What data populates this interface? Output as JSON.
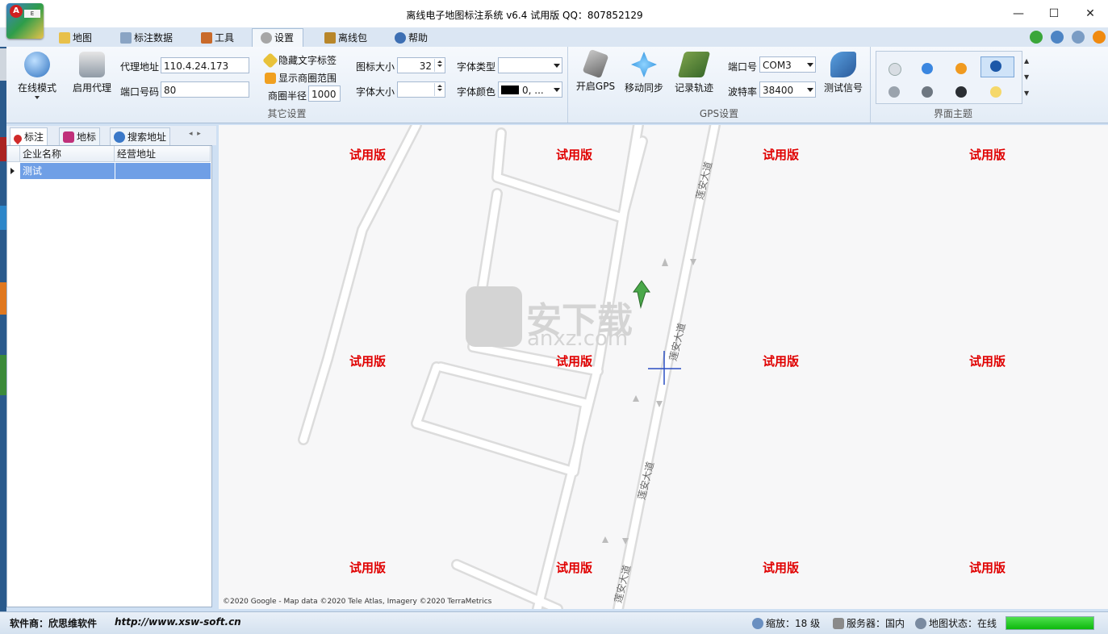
{
  "window": {
    "title": "离线电子地图标注系统 v6.4 试用版 QQ：807852129",
    "minimize_glyph": "—",
    "maximize_glyph": "☐",
    "close_glyph": "✕"
  },
  "tabs": [
    {
      "label": "地图",
      "icon": "map-icon"
    },
    {
      "label": "标注数据",
      "icon": "table-icon"
    },
    {
      "label": "工具",
      "icon": "tools-icon"
    },
    {
      "label": "设置",
      "icon": "settings-icon",
      "active": true
    },
    {
      "label": "离线包",
      "icon": "package-icon"
    },
    {
      "label": "帮助",
      "icon": "help-icon"
    }
  ],
  "ribbon": {
    "online_mode_label": "在线模式",
    "enable_proxy_label": "启用代理",
    "proxy_address_label": "代理地址",
    "proxy_address_value": "110.4.24.173",
    "port_label": "端口号码",
    "port_value": "80",
    "hide_text_label": "隐藏文字标签",
    "show_circle_label": "显示商圈范围",
    "circle_radius_label": "商圈半径",
    "circle_radius_value": "1000",
    "icon_size_label": "图标大小",
    "icon_size_value": "32",
    "font_size_label": "字体大小",
    "font_size_value": "",
    "font_type_label": "字体类型",
    "font_type_value": "",
    "font_color_label": "字体颜色",
    "font_color_value": "0, ...",
    "other_settings_group": "其它设置",
    "open_gps_label": "开启GPS",
    "move_sync_label": "移动同步",
    "record_track_label": "记录轨迹",
    "com_port_label": "端口号",
    "com_port_value": "COM3",
    "baud_label": "波特率",
    "baud_value": "38400",
    "test_signal_label": "测试信号",
    "gps_group": "GPS设置",
    "theme_group": "界面主题"
  },
  "left_panel": {
    "tabs": [
      "标注",
      "地标",
      "搜索地址"
    ],
    "columns": [
      "企业名称",
      "经营地址"
    ],
    "rows": [
      {
        "name": "测试",
        "address": ""
      }
    ]
  },
  "map": {
    "watermark": "试用版",
    "road_name": "莲安大道",
    "logo_text_cn": "安下载",
    "logo_text_en": "anxz.com",
    "copyright": "©2020 Google - Map data ©2020 Tele Atlas, Imagery ©2020 TerraMetrics"
  },
  "status": {
    "vendor": "软件商：欣思维软件",
    "url": "http://www.xsw-soft.cn",
    "zoom": "缩放：18 级",
    "server": "服务器：国内",
    "map_state": "地图状态：在线",
    "progress": 1.0
  },
  "colors": {
    "watermark": "#e00000",
    "selection": "#6f9fe6",
    "progress": "#0eb80e"
  }
}
